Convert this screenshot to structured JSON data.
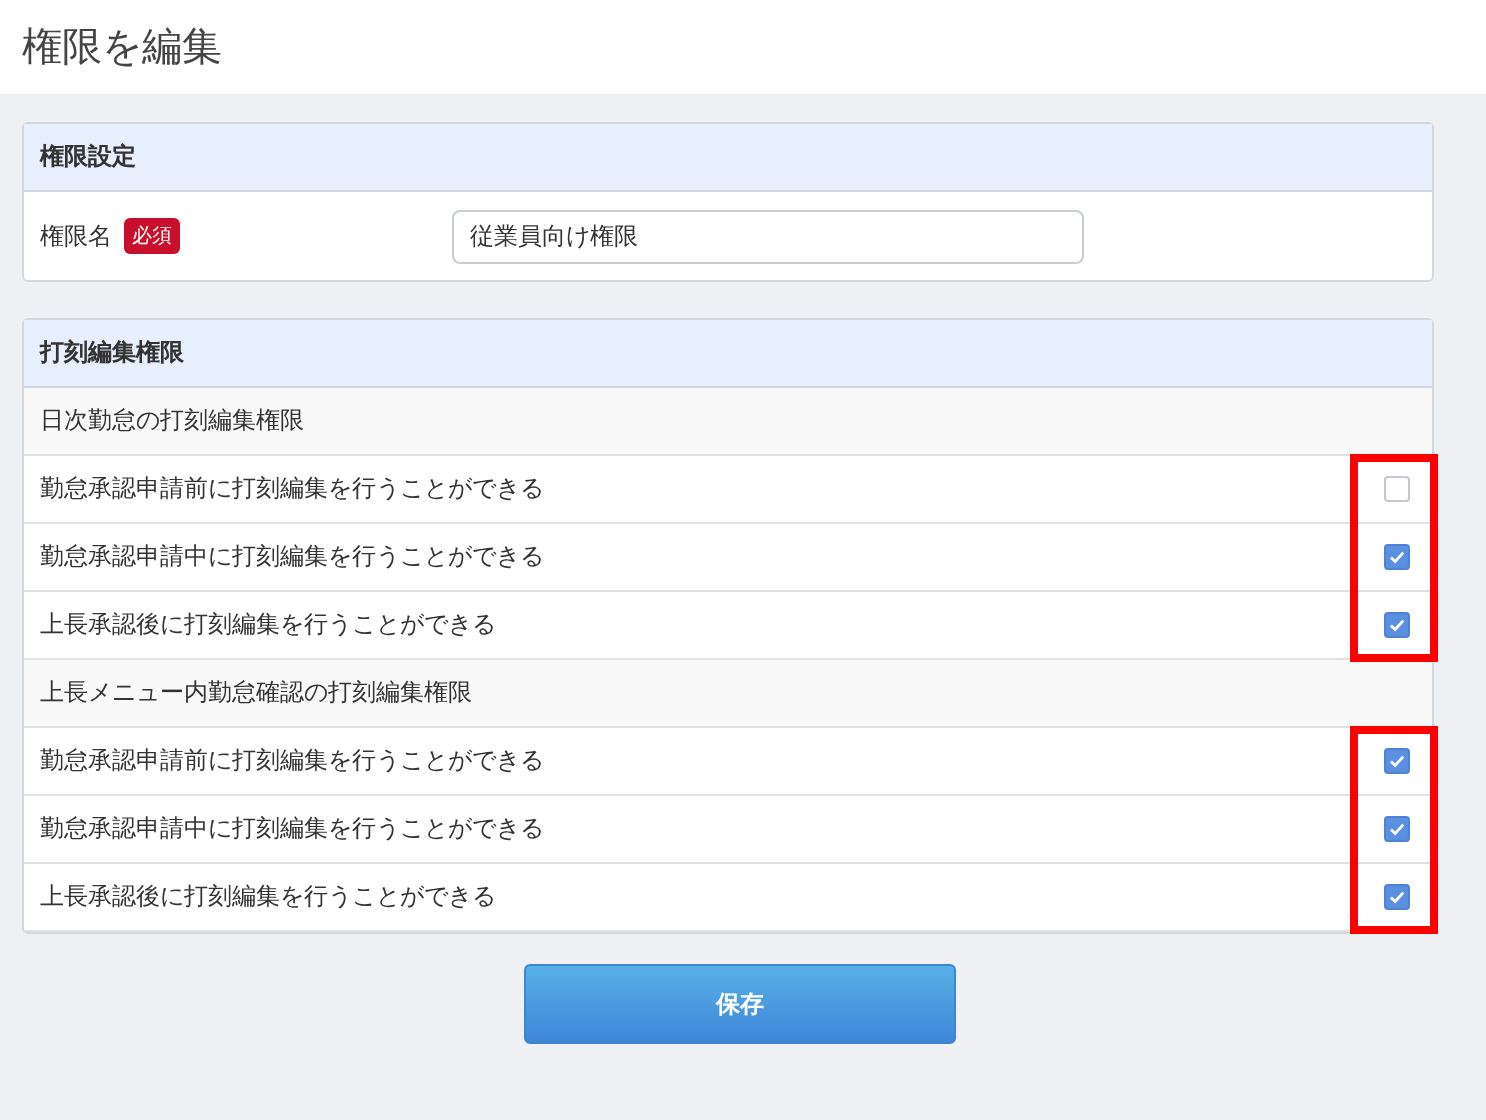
{
  "page": {
    "title": "権限を編集"
  },
  "settings_panel": {
    "title": "権限設定",
    "field_label": "権限名",
    "required_badge": "必須",
    "name_field": {
      "value": "従業員向け権限"
    }
  },
  "permissions_panel": {
    "title": "打刻編集権限",
    "groups": [
      {
        "title": "日次勤怠の打刻編集権限",
        "highlighted": true,
        "items": [
          {
            "label": "勤怠承認申請前に打刻編集を行うことができる",
            "checked": false
          },
          {
            "label": "勤怠承認申請中に打刻編集を行うことができる",
            "checked": true
          },
          {
            "label": "上長承認後に打刻編集を行うことができる",
            "checked": true
          }
        ]
      },
      {
        "title": "上長メニュー内勤怠確認の打刻編集権限",
        "highlighted": true,
        "items": [
          {
            "label": "勤怠承認申請前に打刻編集を行うことができる",
            "checked": true
          },
          {
            "label": "勤怠承認申請中に打刻編集を行うことができる",
            "checked": true
          },
          {
            "label": "上長承認後に打刻編集を行うことができる",
            "checked": true
          }
        ]
      }
    ]
  },
  "save_button": "保存"
}
